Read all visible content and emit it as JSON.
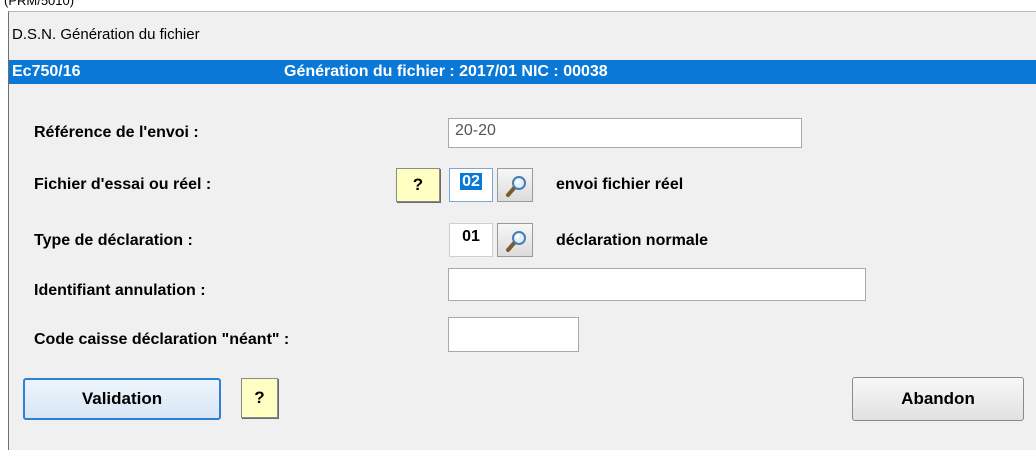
{
  "top_caption": "(PRM/5010)",
  "window": {
    "title": "D.S.N. Génération du fichier"
  },
  "header": {
    "code": "Ec750/16",
    "info": "Génération du fichier : 2017/01 NIC : 00038"
  },
  "form": {
    "reference": {
      "label": "Référence de l'envoi :",
      "value": "20-20"
    },
    "fichier": {
      "label": "Fichier d'essai ou réel :",
      "help_label": "?",
      "code": "02",
      "description": "envoi fichier réel",
      "lookup_icon": "magnifier-icon"
    },
    "type_declaration": {
      "label": "Type de déclaration :",
      "code": "01",
      "description": "déclaration normale",
      "lookup_icon": "magnifier-icon"
    },
    "identifiant_annulation": {
      "label": "Identifiant annulation :",
      "value": ""
    },
    "code_caisse": {
      "label": "Code caisse déclaration \"néant\" :",
      "value": ""
    }
  },
  "buttons": {
    "validation": "Validation",
    "help": "?",
    "abandon": "Abandon"
  },
  "colors": {
    "header_band": "#0a78d7",
    "help_button": "#ffffc4",
    "window_bg": "#f0f0f0"
  }
}
